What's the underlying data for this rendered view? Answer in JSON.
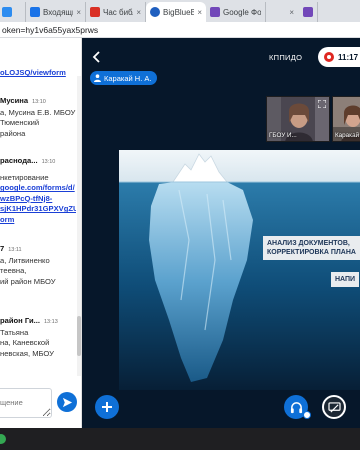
{
  "browser": {
    "tabs": [
      {
        "title": "",
        "favicon_color": "#2d8cf0",
        "active": false
      },
      {
        "title": "Входящие -",
        "favicon_color": "#1a73e8",
        "active": false
      },
      {
        "title": "Час библио",
        "favicon_color": "#d93025",
        "active": false
      },
      {
        "title": "BigBlueB",
        "favicon_color": "#1f5fbf",
        "active": true
      },
      {
        "title": "Google Фор",
        "favicon_color": "#7248b9",
        "active": false
      },
      {
        "title": "",
        "favicon_color": "#7248b9",
        "active": false
      }
    ],
    "address": "oken=hy1v6a55yax5prws"
  },
  "chat": {
    "messages": [
      {
        "lines": [],
        "link_lines": [
          "oLOJSQ/viewform"
        ]
      },
      {
        "name": "Мусина",
        "time": "13:10",
        "lines": [
          "а, Мусина Е.В. МБОУ",
          "Тюменский",
          "района"
        ]
      },
      {
        "name": "раснода...",
        "time": "13:10",
        "lines": [
          "нкетирование"
        ],
        "link_lines": [
          "google.com/forms/d/",
          "wzBPcQ-tfNj8-",
          "sjK1HPdr31GPXVgZU",
          "orm"
        ]
      },
      {
        "name": "7",
        "time": "13:11",
        "lines": [
          "а, Литвиненко",
          "теевна,",
          "ий район МБОУ"
        ]
      },
      {
        "name": "район Ги...",
        "time": "13:13",
        "lines": [
          "Татьяна",
          "на, Каневской",
          "невская, МБОУ"
        ]
      }
    ],
    "input_placeholder": "щение"
  },
  "meeting": {
    "title": "КППИДО",
    "record_time": "11:17",
    "presenter": "Каракай Н. А.",
    "webcams": [
      {
        "label": "ГБОУ И..."
      },
      {
        "label": "Каракай"
      }
    ],
    "slide": {
      "callouts": [
        {
          "lines": [
            "АНАЛИЗ ДОКУМЕНТОВ,",
            "КОРРЕКТИРОВКА ПЛАНА"
          ]
        },
        {
          "lines": [
            "НАПИ"
          ]
        }
      ]
    }
  },
  "icons": {
    "send": "send-icon",
    "plus": "plus-icon",
    "headset": "headset-icon",
    "screenshare": "screenshare-icon"
  },
  "colors": {
    "accent": "#0f70d7",
    "meeting_bg": "#06172a",
    "record": "#df2721",
    "link": "#1a3fd6"
  }
}
